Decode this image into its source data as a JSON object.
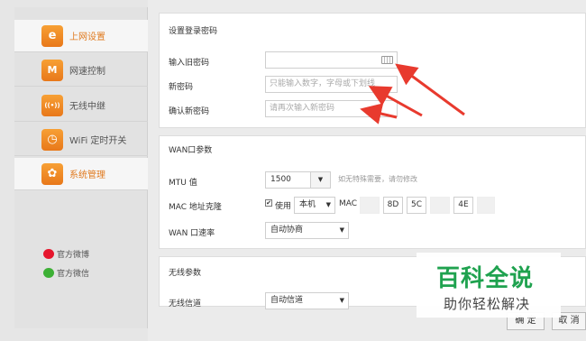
{
  "sidebar": {
    "items": [
      {
        "label": "上网设置",
        "icon": "e-icon",
        "glyph": "e"
      },
      {
        "label": "网速控制",
        "icon": "speed-icon",
        "glyph": "M"
      },
      {
        "label": "无线中继",
        "icon": "wifi-icon",
        "glyph": "((•))"
      },
      {
        "label": "WiFi 定时开关",
        "icon": "timer-icon",
        "glyph": "◷"
      },
      {
        "label": "系统管理",
        "icon": "gear-icon",
        "glyph": "✿"
      }
    ],
    "weibo": "官方微博",
    "wechat": "官方微信"
  },
  "password_section": {
    "title": "设置登录密码",
    "old_label": "输入旧密码",
    "new_label": "新密码",
    "new_placeholder": "只能输入数字，字母或下划线",
    "confirm_label": "确认新密码",
    "confirm_placeholder": "请再次输入新密码"
  },
  "wan_section": {
    "title": "WAN口参数",
    "mtu_label": "MTU 值",
    "mtu_value": "1500",
    "mtu_hint": "如无特殊需要，请勿修改",
    "mac_label": "MAC 地址克隆",
    "use_label": "使用",
    "mac_mode": "本机",
    "mac_text": "MAC",
    "mac_parts": [
      "",
      "8D",
      "5C",
      "",
      "4E",
      ""
    ],
    "rate_label": "WAN 口速率",
    "rate_value": "自动协商"
  },
  "wireless_section": {
    "title": "无线参数",
    "channel_label": "无线信道",
    "channel_value": "自动信道"
  },
  "footer": {
    "confirm": "确 定",
    "cancel": "取 消"
  },
  "watermark": {
    "title": "百科全说",
    "subtitle": "助你轻松解决"
  },
  "colors": {
    "accent": "#e07a1f",
    "arrow": "#e83a2e",
    "watermark_green": "#1fa24f"
  }
}
